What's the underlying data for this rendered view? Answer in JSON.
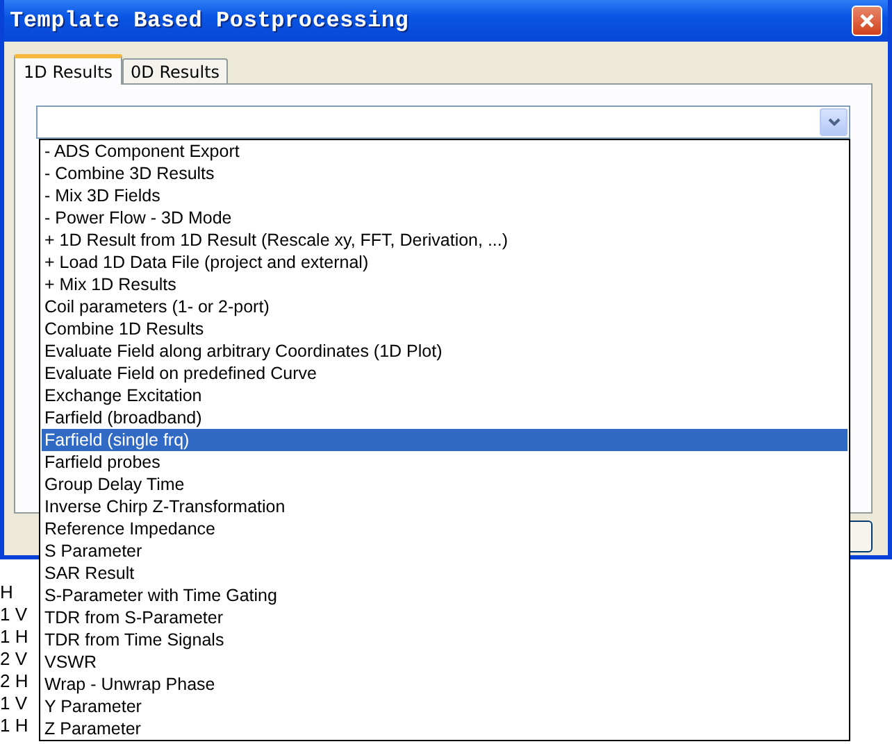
{
  "window": {
    "title": "Template Based Postprocessing"
  },
  "tabs": [
    {
      "label": "1D Results",
      "selected": true
    },
    {
      "label": "0D Results",
      "selected": false
    }
  ],
  "template_dropdown": {
    "expanded": true,
    "options": [
      {
        "label": "- ADS Component Export",
        "selected": false
      },
      {
        "label": "- Combine 3D Results",
        "selected": false
      },
      {
        "label": "- Mix 3D Fields",
        "selected": false
      },
      {
        "label": "- Power Flow - 3D Mode",
        "selected": false
      },
      {
        "label": "+ 1D Result from 1D Result (Rescale xy, FFT, Derivation, ...)",
        "selected": false
      },
      {
        "label": "+ Load 1D Data File (project and external)",
        "selected": false
      },
      {
        "label": "+ Mix 1D Results",
        "selected": false
      },
      {
        "label": "Coil parameters (1- or 2-port)",
        "selected": false
      },
      {
        "label": "Combine 1D Results",
        "selected": false
      },
      {
        "label": "Evaluate Field along arbitrary Coordinates (1D Plot)",
        "selected": false
      },
      {
        "label": "Evaluate Field on predefined Curve",
        "selected": false
      },
      {
        "label": "Exchange Excitation",
        "selected": false
      },
      {
        "label": "Farfield (broadband)",
        "selected": false
      },
      {
        "label": "Farfield (single frq)",
        "selected": true
      },
      {
        "label": "Farfield probes",
        "selected": false
      },
      {
        "label": "Group Delay Time",
        "selected": false
      },
      {
        "label": "Inverse Chirp Z-Transformation",
        "selected": false
      },
      {
        "label": "Reference Impedance",
        "selected": false
      },
      {
        "label": "S Parameter",
        "selected": false
      },
      {
        "label": "SAR Result",
        "selected": false
      },
      {
        "label": "S-Parameter with Time Gating",
        "selected": false
      },
      {
        "label": "TDR from S-Parameter",
        "selected": false
      },
      {
        "label": "TDR from Time Signals",
        "selected": false
      },
      {
        "label": "VSWR",
        "selected": false
      },
      {
        "label": "Wrap - Unwrap Phase",
        "selected": false
      },
      {
        "label": "Y Parameter",
        "selected": false
      },
      {
        "label": "Z Parameter",
        "selected": false
      }
    ]
  },
  "background_labels": [
    "H",
    "1 V",
    "1 H",
    "2 V",
    "2 H",
    "1 V",
    "1 H"
  ]
}
